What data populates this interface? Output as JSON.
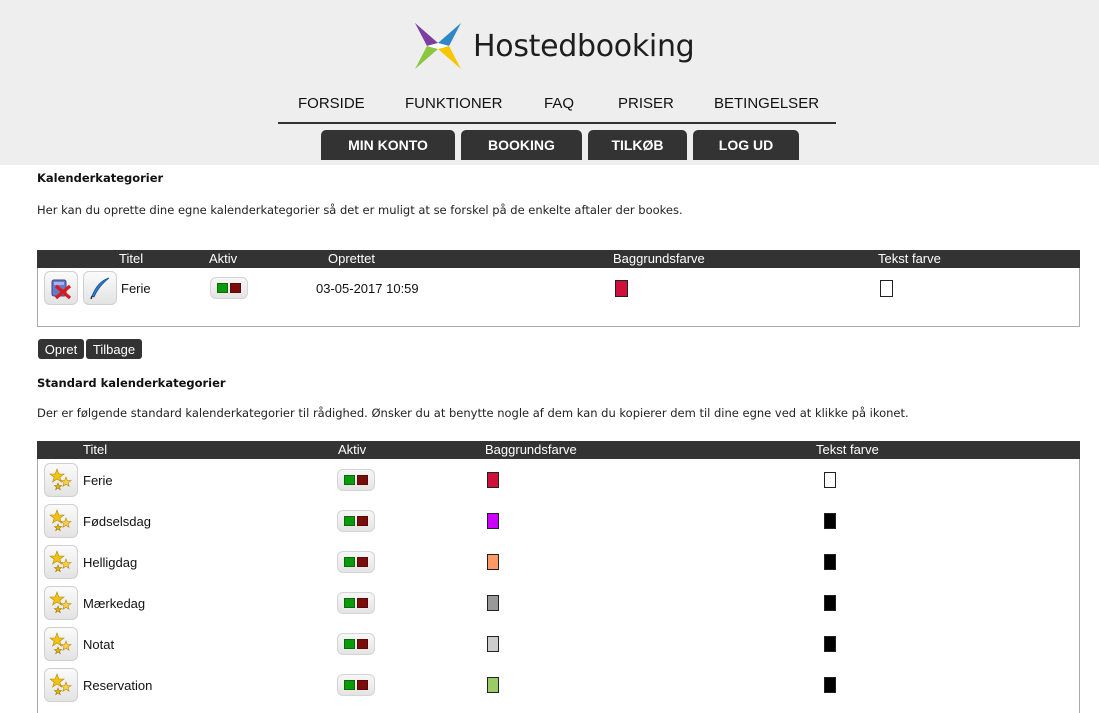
{
  "brand": {
    "name": "Hostedbooking"
  },
  "topnav": [
    "FORSIDE",
    "FUNKTIONER",
    "FAQ",
    "PRISER",
    "BETINGELSER"
  ],
  "buttonnav": [
    "MIN KONTO",
    "BOOKING",
    "TILKØB",
    "LOG UD"
  ],
  "section1": {
    "title": "Kalenderkategorier",
    "description": "Her kan du oprette dine egne kalenderkategorier så det er muligt at se forskel på de enkelte aftaler der bookes.",
    "columns": [
      "Titel",
      "Aktiv",
      "Oprettet",
      "Baggrundsfarve",
      "Tekst farve"
    ],
    "rows": [
      {
        "title": "Ferie",
        "created": "03-05-2017 10:59",
        "bg_color": "#d0103a",
        "text_color": "#ffffff"
      }
    ]
  },
  "actions": {
    "create": "Opret",
    "back": "Tilbage"
  },
  "section2": {
    "title": "Standard kalenderkategorier",
    "description": "Der er følgende standard kalenderkategorier til rådighed. Ønsker du at benytte nogle af dem kan du kopierer dem til dine egne ved at klikke på ikonet.",
    "columns": [
      "Titel",
      "Aktiv",
      "Baggrundsfarve",
      "Tekst farve"
    ],
    "rows": [
      {
        "title": "Ferie",
        "bg_color": "#d0103a",
        "text_color": "#ffffff"
      },
      {
        "title": "Fødselsdag",
        "bg_color": "#cc00ff",
        "text_color": "#000000"
      },
      {
        "title": "Helligdag",
        "bg_color": "#ff9966",
        "text_color": "#000000"
      },
      {
        "title": "Mærkedag",
        "bg_color": "#999999",
        "text_color": "#000000"
      },
      {
        "title": "Notat",
        "bg_color": "#cccccc",
        "text_color": "#000000"
      },
      {
        "title": "Reservation",
        "bg_color": "#99cc66",
        "text_color": "#000000"
      }
    ]
  },
  "colors": {
    "header_bg": "#eeeeee",
    "dark": "#333333",
    "active_on": "#0a9a0a",
    "active_off": "#7a0c0c"
  }
}
